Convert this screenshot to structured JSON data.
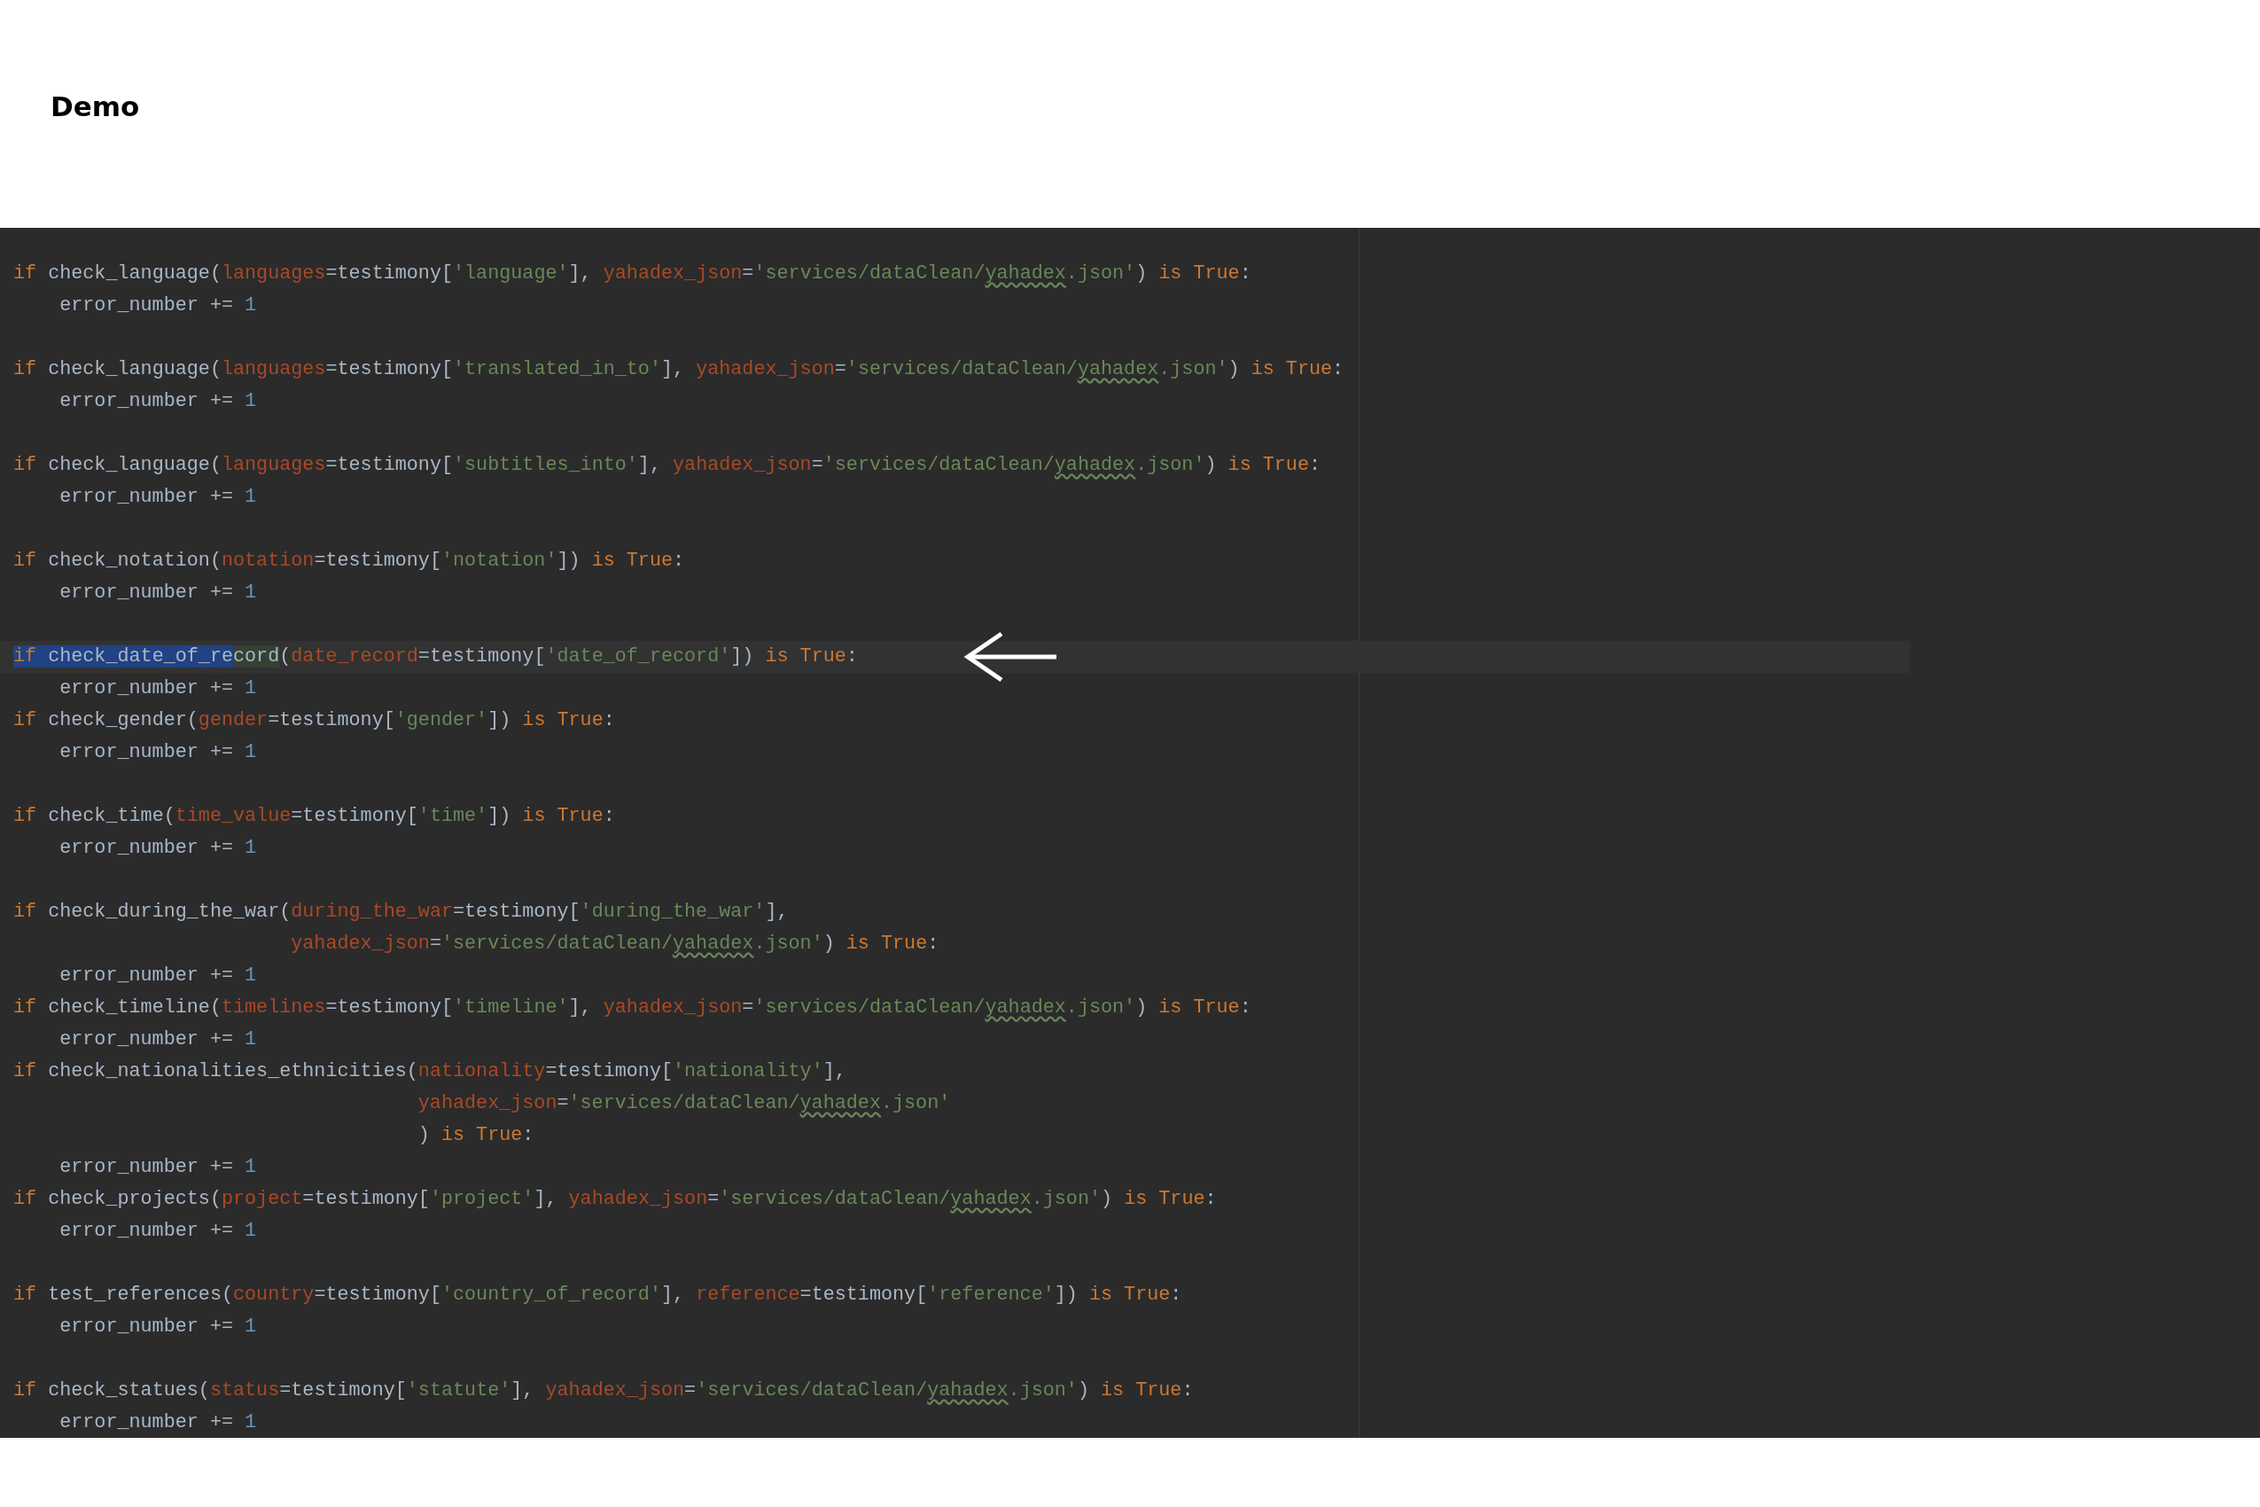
{
  "page": {
    "title": "Demo"
  },
  "editor": {
    "lines": [
      {
        "kind": "statement",
        "tokens": [
          {
            "kind": "kw",
            "text": "if"
          },
          {
            "kind": "plain",
            "text": " check_language("
          },
          {
            "kind": "param",
            "text": "languages"
          },
          {
            "kind": "plain",
            "text": "=testimony["
          },
          {
            "kind": "str",
            "text": "'language'"
          },
          {
            "kind": "plain",
            "text": "], "
          },
          {
            "kind": "param",
            "text": "yahadex_json"
          },
          {
            "kind": "plain",
            "text": "="
          },
          {
            "kind": "str",
            "text": "'services/dataClean/"
          },
          {
            "kind": "typo",
            "text": "yahadex"
          },
          {
            "kind": "str",
            "text": ".json'"
          },
          {
            "kind": "plain",
            "text": ") "
          },
          {
            "kind": "kw",
            "text": "is True"
          },
          {
            "kind": "plain",
            "text": ":"
          }
        ]
      },
      {
        "kind": "body",
        "tokens": [
          {
            "kind": "plain",
            "text": "error_number += "
          },
          {
            "kind": "num",
            "text": "1"
          }
        ]
      },
      {
        "kind": "blank"
      },
      {
        "kind": "statement",
        "tokens": [
          {
            "kind": "kw",
            "text": "if"
          },
          {
            "kind": "plain",
            "text": " check_language("
          },
          {
            "kind": "param",
            "text": "languages"
          },
          {
            "kind": "plain",
            "text": "=testimony["
          },
          {
            "kind": "str",
            "text": "'translated_in_to'"
          },
          {
            "kind": "plain",
            "text": "], "
          },
          {
            "kind": "param",
            "text": "yahadex_json"
          },
          {
            "kind": "plain",
            "text": "="
          },
          {
            "kind": "str",
            "text": "'services/dataClean/"
          },
          {
            "kind": "typo",
            "text": "yahadex"
          },
          {
            "kind": "str",
            "text": ".json'"
          },
          {
            "kind": "plain",
            "text": ") "
          },
          {
            "kind": "kw",
            "text": "is True"
          },
          {
            "kind": "plain",
            "text": ":"
          }
        ]
      },
      {
        "kind": "body",
        "tokens": [
          {
            "kind": "plain",
            "text": "error_number += "
          },
          {
            "kind": "num",
            "text": "1"
          }
        ]
      },
      {
        "kind": "blank"
      },
      {
        "kind": "statement",
        "tokens": [
          {
            "kind": "kw",
            "text": "if"
          },
          {
            "kind": "plain",
            "text": " check_language("
          },
          {
            "kind": "param",
            "text": "languages"
          },
          {
            "kind": "plain",
            "text": "=testimony["
          },
          {
            "kind": "str",
            "text": "'subtitles_into'"
          },
          {
            "kind": "plain",
            "text": "], "
          },
          {
            "kind": "param",
            "text": "yahadex_json"
          },
          {
            "kind": "plain",
            "text": "="
          },
          {
            "kind": "str",
            "text": "'services/dataClean/"
          },
          {
            "kind": "typo",
            "text": "yahadex"
          },
          {
            "kind": "str",
            "text": ".json'"
          },
          {
            "kind": "plain",
            "text": ") "
          },
          {
            "kind": "kw",
            "text": "is True"
          },
          {
            "kind": "plain",
            "text": ":"
          }
        ]
      },
      {
        "kind": "body",
        "tokens": [
          {
            "kind": "plain",
            "text": "error_number += "
          },
          {
            "kind": "num",
            "text": "1"
          }
        ]
      },
      {
        "kind": "blank"
      },
      {
        "kind": "statement",
        "tokens": [
          {
            "kind": "kw",
            "text": "if"
          },
          {
            "kind": "plain",
            "text": " check_notation("
          },
          {
            "kind": "param",
            "text": "notation"
          },
          {
            "kind": "plain",
            "text": "=testimony["
          },
          {
            "kind": "str",
            "text": "'notation'"
          },
          {
            "kind": "plain",
            "text": "]) "
          },
          {
            "kind": "kw",
            "text": "is True"
          },
          {
            "kind": "plain",
            "text": ":"
          }
        ]
      },
      {
        "kind": "body",
        "tokens": [
          {
            "kind": "plain",
            "text": "error_number += "
          },
          {
            "kind": "num",
            "text": "1"
          }
        ]
      },
      {
        "kind": "blank"
      },
      {
        "kind": "statement",
        "current": true,
        "tokens": [
          {
            "kind": "kw",
            "text": "if",
            "selected": true
          },
          {
            "kind": "plain",
            "text": " check_date_of_re",
            "selected": true
          },
          {
            "kind": "plain",
            "text": "cord",
            "matched": true
          },
          {
            "kind": "plain",
            "text": "("
          },
          {
            "kind": "param",
            "text": "date_record"
          },
          {
            "kind": "plain",
            "text": "=testimony["
          },
          {
            "kind": "str",
            "text": "'date_of_record'"
          },
          {
            "kind": "plain",
            "text": "]) "
          },
          {
            "kind": "kw",
            "text": "is True"
          },
          {
            "kind": "plain",
            "text": ":"
          }
        ]
      },
      {
        "kind": "body",
        "tokens": [
          {
            "kind": "plain",
            "text": "error_number += "
          },
          {
            "kind": "num",
            "text": "1"
          }
        ]
      },
      {
        "kind": "statement",
        "tokens": [
          {
            "kind": "kw",
            "text": "if"
          },
          {
            "kind": "plain",
            "text": " check_gender("
          },
          {
            "kind": "param",
            "text": "gender"
          },
          {
            "kind": "plain",
            "text": "=testimony["
          },
          {
            "kind": "str",
            "text": "'gender'"
          },
          {
            "kind": "plain",
            "text": "]) "
          },
          {
            "kind": "kw",
            "text": "is True"
          },
          {
            "kind": "plain",
            "text": ":"
          }
        ]
      },
      {
        "kind": "body",
        "tokens": [
          {
            "kind": "plain",
            "text": "error_number += "
          },
          {
            "kind": "num",
            "text": "1"
          }
        ]
      },
      {
        "kind": "blank"
      },
      {
        "kind": "statement",
        "tokens": [
          {
            "kind": "kw",
            "text": "if"
          },
          {
            "kind": "plain",
            "text": " check_time("
          },
          {
            "kind": "param",
            "text": "time_value"
          },
          {
            "kind": "plain",
            "text": "=testimony["
          },
          {
            "kind": "str",
            "text": "'time'"
          },
          {
            "kind": "plain",
            "text": "]) "
          },
          {
            "kind": "kw",
            "text": "is True"
          },
          {
            "kind": "plain",
            "text": ":"
          }
        ]
      },
      {
        "kind": "body",
        "tokens": [
          {
            "kind": "plain",
            "text": "error_number += "
          },
          {
            "kind": "num",
            "text": "1"
          }
        ]
      },
      {
        "kind": "blank"
      },
      {
        "kind": "statement",
        "tokens": [
          {
            "kind": "kw",
            "text": "if"
          },
          {
            "kind": "plain",
            "text": " check_during_the_war("
          },
          {
            "kind": "param",
            "text": "during_the_war"
          },
          {
            "kind": "plain",
            "text": "=testimony["
          },
          {
            "kind": "str",
            "text": "'during_the_war'"
          },
          {
            "kind": "plain",
            "text": "],"
          }
        ]
      },
      {
        "kind": "continued",
        "tokens": [
          {
            "kind": "param",
            "text": "yahadex_json"
          },
          {
            "kind": "plain",
            "text": "="
          },
          {
            "kind": "str",
            "text": "'services/dataClean/"
          },
          {
            "kind": "typo",
            "text": "yahadex"
          },
          {
            "kind": "str",
            "text": ".json'"
          },
          {
            "kind": "plain",
            "text": ") "
          },
          {
            "kind": "kw",
            "text": "is True"
          },
          {
            "kind": "plain",
            "text": ":"
          }
        ]
      },
      {
        "kind": "body",
        "tokens": [
          {
            "kind": "plain",
            "text": "error_number += "
          },
          {
            "kind": "num",
            "text": "1"
          }
        ]
      },
      {
        "kind": "statement",
        "tokens": [
          {
            "kind": "kw",
            "text": "if"
          },
          {
            "kind": "plain",
            "text": " check_timeline("
          },
          {
            "kind": "param",
            "text": "timelines"
          },
          {
            "kind": "plain",
            "text": "=testimony["
          },
          {
            "kind": "str",
            "text": "'timeline'"
          },
          {
            "kind": "plain",
            "text": "], "
          },
          {
            "kind": "param",
            "text": "yahadex_json"
          },
          {
            "kind": "plain",
            "text": "="
          },
          {
            "kind": "str",
            "text": "'services/dataClean/"
          },
          {
            "kind": "typo",
            "text": "yahadex"
          },
          {
            "kind": "str",
            "text": ".json'"
          },
          {
            "kind": "plain",
            "text": ") "
          },
          {
            "kind": "kw",
            "text": "is True"
          },
          {
            "kind": "plain",
            "text": ":"
          }
        ]
      },
      {
        "kind": "body",
        "tokens": [
          {
            "kind": "plain",
            "text": "error_number += "
          },
          {
            "kind": "num",
            "text": "1"
          }
        ]
      },
      {
        "kind": "statement",
        "tokens": [
          {
            "kind": "kw",
            "text": "if"
          },
          {
            "kind": "plain",
            "text": " check_nationalities_ethnicities("
          },
          {
            "kind": "param",
            "text": "nationality"
          },
          {
            "kind": "plain",
            "text": "=testimony["
          },
          {
            "kind": "str",
            "text": "'nationality'"
          },
          {
            "kind": "plain",
            "text": "],"
          }
        ]
      },
      {
        "kind": "continued",
        "tokens": [
          {
            "kind": "param",
            "text": "yahadex_json"
          },
          {
            "kind": "plain",
            "text": "="
          },
          {
            "kind": "str",
            "text": "'services/dataClean/"
          },
          {
            "kind": "typo",
            "text": "yahadex"
          },
          {
            "kind": "str",
            "text": ".json'"
          }
        ]
      },
      {
        "kind": "continued",
        "tokens": [
          {
            "kind": "plain",
            "text": ") "
          },
          {
            "kind": "kw",
            "text": "is True"
          },
          {
            "kind": "plain",
            "text": ":"
          }
        ]
      },
      {
        "kind": "body",
        "tokens": [
          {
            "kind": "plain",
            "text": "error_number += "
          },
          {
            "kind": "num",
            "text": "1"
          }
        ]
      },
      {
        "kind": "statement",
        "tokens": [
          {
            "kind": "kw",
            "text": "if"
          },
          {
            "kind": "plain",
            "text": " check_projects("
          },
          {
            "kind": "param",
            "text": "project"
          },
          {
            "kind": "plain",
            "text": "=testimony["
          },
          {
            "kind": "str",
            "text": "'project'"
          },
          {
            "kind": "plain",
            "text": "], "
          },
          {
            "kind": "param",
            "text": "yahadex_json"
          },
          {
            "kind": "plain",
            "text": "="
          },
          {
            "kind": "str",
            "text": "'services/dataClean/"
          },
          {
            "kind": "typo",
            "text": "yahadex"
          },
          {
            "kind": "str",
            "text": ".json'"
          },
          {
            "kind": "plain",
            "text": ") "
          },
          {
            "kind": "kw",
            "text": "is True"
          },
          {
            "kind": "plain",
            "text": ":"
          }
        ]
      },
      {
        "kind": "body",
        "tokens": [
          {
            "kind": "plain",
            "text": "error_number += "
          },
          {
            "kind": "num",
            "text": "1"
          }
        ]
      },
      {
        "kind": "blank"
      },
      {
        "kind": "statement",
        "tokens": [
          {
            "kind": "kw",
            "text": "if"
          },
          {
            "kind": "plain",
            "text": " test_references("
          },
          {
            "kind": "param",
            "text": "country"
          },
          {
            "kind": "plain",
            "text": "=testimony["
          },
          {
            "kind": "str",
            "text": "'country_of_record'"
          },
          {
            "kind": "plain",
            "text": "], "
          },
          {
            "kind": "param",
            "text": "reference"
          },
          {
            "kind": "plain",
            "text": "=testimony["
          },
          {
            "kind": "str",
            "text": "'reference'"
          },
          {
            "kind": "plain",
            "text": "]) "
          },
          {
            "kind": "kw",
            "text": "is True"
          },
          {
            "kind": "plain",
            "text": ":"
          }
        ]
      },
      {
        "kind": "body",
        "tokens": [
          {
            "kind": "plain",
            "text": "error_number += "
          },
          {
            "kind": "num",
            "text": "1"
          }
        ]
      },
      {
        "kind": "blank"
      },
      {
        "kind": "statement",
        "tokens": [
          {
            "kind": "kw",
            "text": "if"
          },
          {
            "kind": "plain",
            "text": " check_statues("
          },
          {
            "kind": "param",
            "text": "status"
          },
          {
            "kind": "plain",
            "text": "=testimony["
          },
          {
            "kind": "str",
            "text": "'statute'"
          },
          {
            "kind": "plain",
            "text": "], "
          },
          {
            "kind": "param",
            "text": "yahadex_json"
          },
          {
            "kind": "plain",
            "text": "="
          },
          {
            "kind": "str",
            "text": "'services/dataClean/"
          },
          {
            "kind": "typo",
            "text": "yahadex"
          },
          {
            "kind": "str",
            "text": ".json'"
          },
          {
            "kind": "plain",
            "text": ") "
          },
          {
            "kind": "kw",
            "text": "is True"
          },
          {
            "kind": "plain",
            "text": ":"
          }
        ]
      },
      {
        "kind": "body",
        "tokens": [
          {
            "kind": "plain",
            "text": "error_number += "
          },
          {
            "kind": "num",
            "text": "1"
          }
        ]
      }
    ]
  }
}
